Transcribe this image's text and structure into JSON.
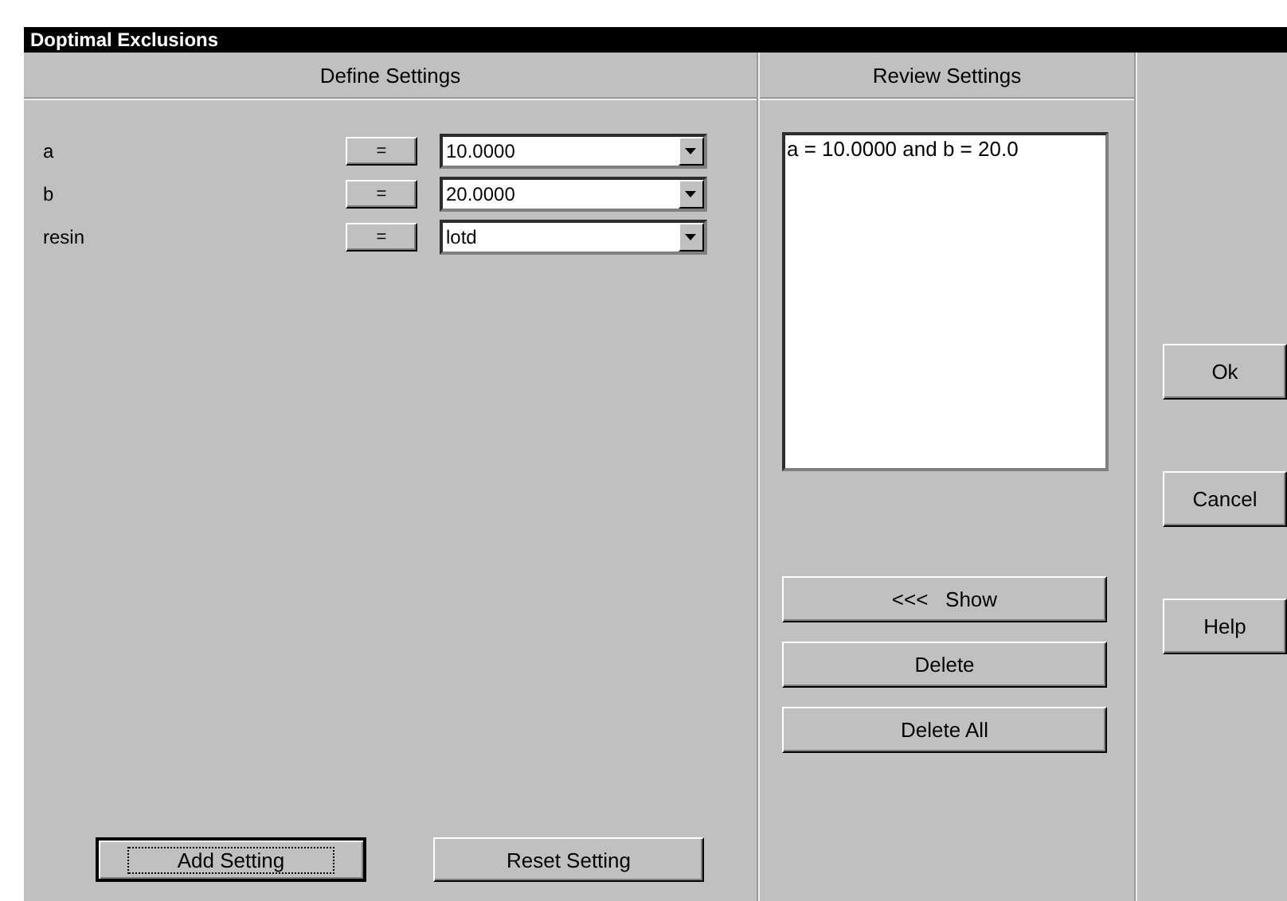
{
  "window": {
    "title": "Doptimal Exclusions"
  },
  "define": {
    "header": "Define Settings",
    "rows": [
      {
        "name": "a",
        "op": "=",
        "value": "10.0000"
      },
      {
        "name": "b",
        "op": "=",
        "value": "20.0000"
      },
      {
        "name": "resin",
        "op": "=",
        "value": "lotd"
      }
    ],
    "buttons": [
      {
        "label": "Add Setting",
        "focused": true
      },
      {
        "label": "Reset Setting",
        "focused": false
      }
    ]
  },
  "review": {
    "header": "Review Settings",
    "items": [
      "a = 10.0000 and b = 20.0"
    ],
    "buttons": [
      "<<<   Show",
      "Delete",
      "Delete All"
    ]
  },
  "dialog_buttons": [
    "Ok",
    "Cancel",
    "Help"
  ]
}
